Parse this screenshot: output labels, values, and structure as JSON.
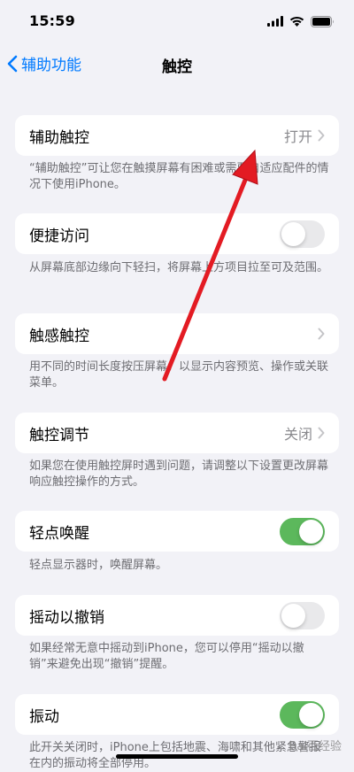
{
  "status": {
    "time": "15:59"
  },
  "nav": {
    "back_label": "辅助功能",
    "title": "触控"
  },
  "settings": [
    {
      "label": "辅助触控",
      "value": "打开",
      "control": "chevron",
      "footer": "“辅助触控”可让您在触摸屏幕有困难或需要自适应配件的情况下使用iPhone。"
    },
    {
      "label": "便捷访问",
      "control": "toggle",
      "on": false,
      "footer": "从屏幕底部边缘向下轻扫，将屏幕上方项目拉至可及范围。"
    },
    {
      "label": "触感触控",
      "control": "chevron",
      "footer": "用不同的时间长度按压屏幕，以显示内容预览、操作或关联菜单。"
    },
    {
      "label": "触控调节",
      "value": "关闭",
      "control": "chevron",
      "footer": "如果您在使用触控屏时遇到问题，请调整以下设置更改屏幕响应触控操作的方式。"
    },
    {
      "label": "轻点唤醒",
      "control": "toggle",
      "on": true,
      "footer": "轻点显示器时，唤醒屏幕。"
    },
    {
      "label": "摇动以撤销",
      "control": "toggle",
      "on": false,
      "footer": "如果经常无意中摇动到iPhone，您可以停用“摇动以撤销”来避免出现“撤销”提醒。"
    },
    {
      "label": "振动",
      "control": "toggle",
      "on": true,
      "footer": "此开关关闭时，iPhone上包括地震、海啸和其他紧急警报在内的振动将全部停用。"
    }
  ],
  "watermark": "Bai百经验",
  "colors": {
    "accent": "#007aff",
    "toggle_on": "#5cb85c",
    "annotation_arrow": "#e31b23"
  }
}
